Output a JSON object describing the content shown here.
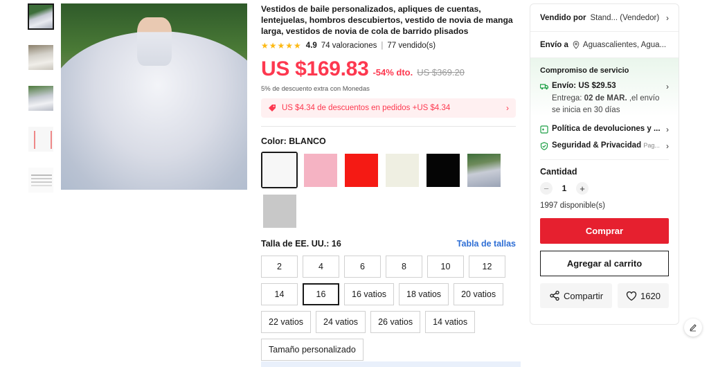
{
  "product": {
    "title": "Vestidos de baile personalizados, apliques de cuentas, lentejuelas, hombros descubiertos, vestido de novia de manga larga, vestidos de novia de cola de barrido plisados",
    "stars": "★★★★★",
    "rating": "4.9",
    "reviews": "74 valoraciones",
    "sold": "77 vendido(s)",
    "price": "US $169.83",
    "discount": "-54% dto.",
    "original_price": "US $369.20",
    "coins_note": "5% de descuento extra con Monedas",
    "coupon_text": "US $4.34 de descuentos en pedidos +US $4.34"
  },
  "color": {
    "label": "Color: BLANCO",
    "swatches": [
      {
        "name": "blanco",
        "hex": "#f7f7f7",
        "selected": true
      },
      {
        "name": "rosa",
        "hex": "#f5b3c3"
      },
      {
        "name": "rojo",
        "hex": "#f51a14"
      },
      {
        "name": "marfil",
        "hex": "#efefe2"
      },
      {
        "name": "negro",
        "hex": "#050505"
      },
      {
        "name": "foto",
        "hex": "#8f95a3"
      },
      {
        "name": "gris",
        "hex": "#c8c8c8"
      }
    ]
  },
  "size": {
    "label": "Talla de EE. UU.: 16",
    "chart_link": "Tabla de tallas",
    "options": [
      "2",
      "4",
      "6",
      "8",
      "10",
      "12",
      "14",
      "16",
      "16 vatios",
      "18 vatios",
      "20 vatios",
      "22 vatios",
      "24 vatios",
      "26 vatios",
      "14 vatios",
      "Tamaño personalizado"
    ],
    "selected": "16"
  },
  "seller": {
    "label": "Vendido por",
    "value": "Stand... (Vendedor)"
  },
  "shipping": {
    "label": "Envío a",
    "location": "Aguascalientes, Agua..."
  },
  "service": {
    "title": "Compromiso de servicio",
    "shipping_cost": "Envío: US $29.53",
    "delivery_prefix": "Entrega: ",
    "delivery_date": "02 de MAR.",
    "delivery_suffix": " ,el envío se inicia en 30 días",
    "returns": "Política de devoluciones y ...",
    "security": "Seguridad & Privacidad",
    "security_note": "Pag..."
  },
  "quantity": {
    "label": "Cantidad",
    "value": "1",
    "available": "1997 disponible(s)",
    "minus": "−",
    "plus": "+"
  },
  "buttons": {
    "buy": "Comprar",
    "cart": "Agregar al carrito",
    "share": "Compartir",
    "wishlist": "1620"
  },
  "colors": {
    "accent_red": "#fd384f",
    "buy_red": "#e6202f",
    "link_blue": "#2f6fd5",
    "service_green": "#1a9e43",
    "star_yellow": "#fdb913"
  }
}
